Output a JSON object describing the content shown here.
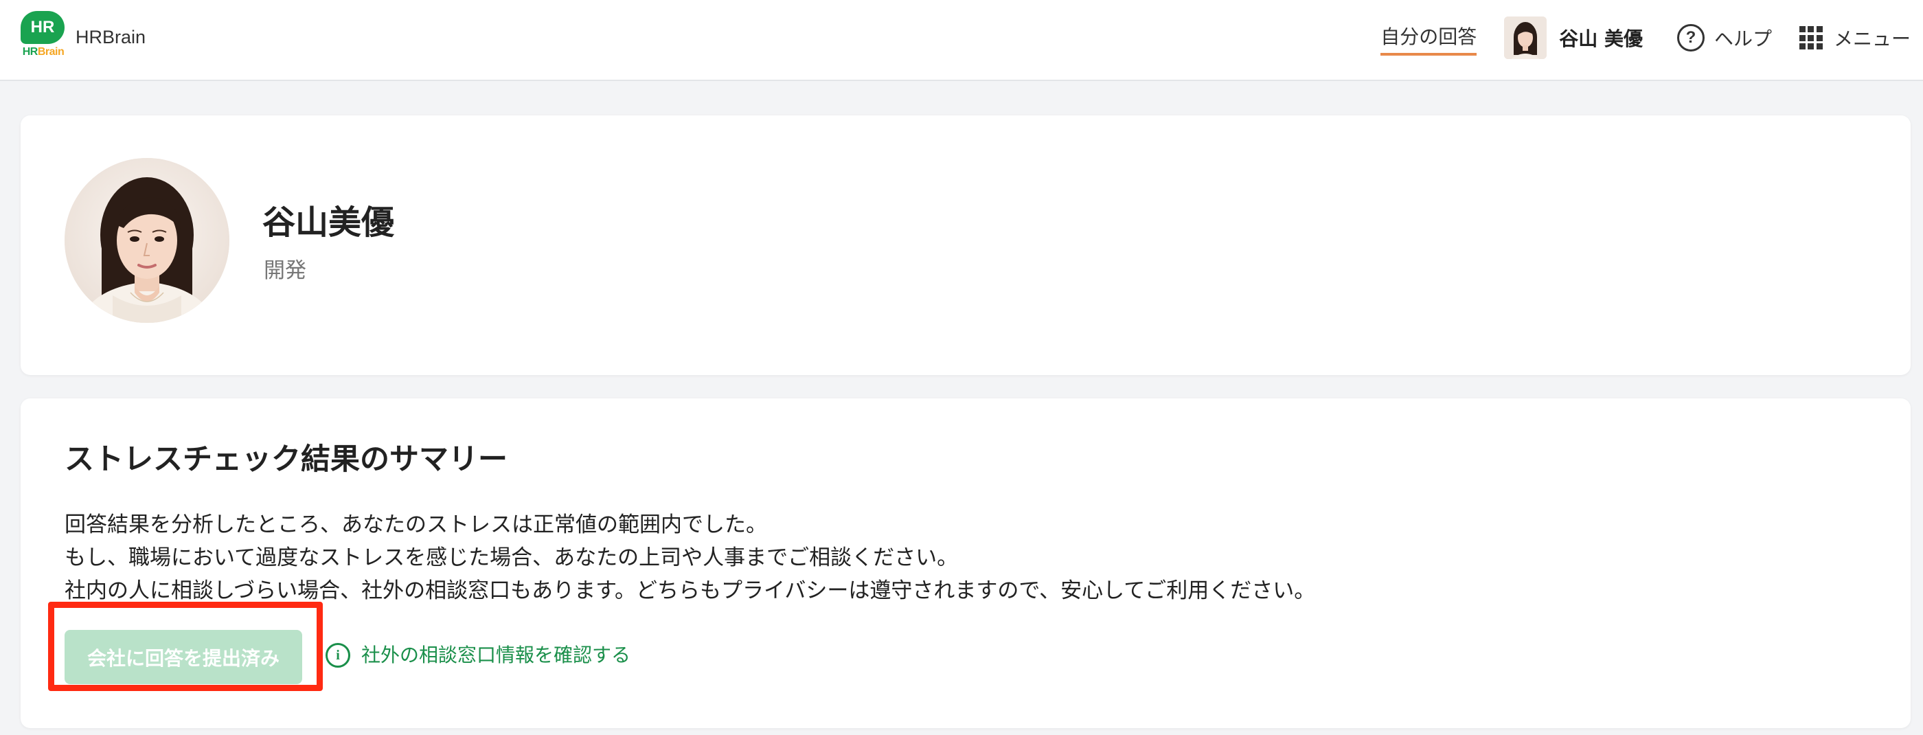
{
  "header": {
    "logo_text": "HR",
    "logo_sub_primary": "HR",
    "logo_sub_accent": "Brain",
    "app_name": "HRBrain",
    "nav_my_answers": "自分の回答",
    "user_name": "谷山 美優",
    "help_icon_glyph": "?",
    "help_label": "ヘルプ",
    "menu_label": "メニュー",
    "accent_color": "#e8894a"
  },
  "profile": {
    "name": "谷山美優",
    "department": "開発"
  },
  "summary": {
    "title": "ストレスチェック結果のサマリー",
    "lines": [
      "回答結果を分析したところ、あなたのストレスは正常値の範囲内でした。",
      "もし、職場において過度なストレスを感じた場合、あなたの上司や人事までご相談ください。",
      "社内の人に相談しづらい場合、社外の相談窓口もあります。どちらもプライバシーは遵守されますので、安心してご利用ください。"
    ],
    "submitted_button_label": "会社に回答を提出済み",
    "info_icon_glyph": "i",
    "external_consult_link": "社外の相談窓口情報を確認する",
    "brand_color": "#1a8f4a",
    "highlight_color": "#ff2a12"
  }
}
